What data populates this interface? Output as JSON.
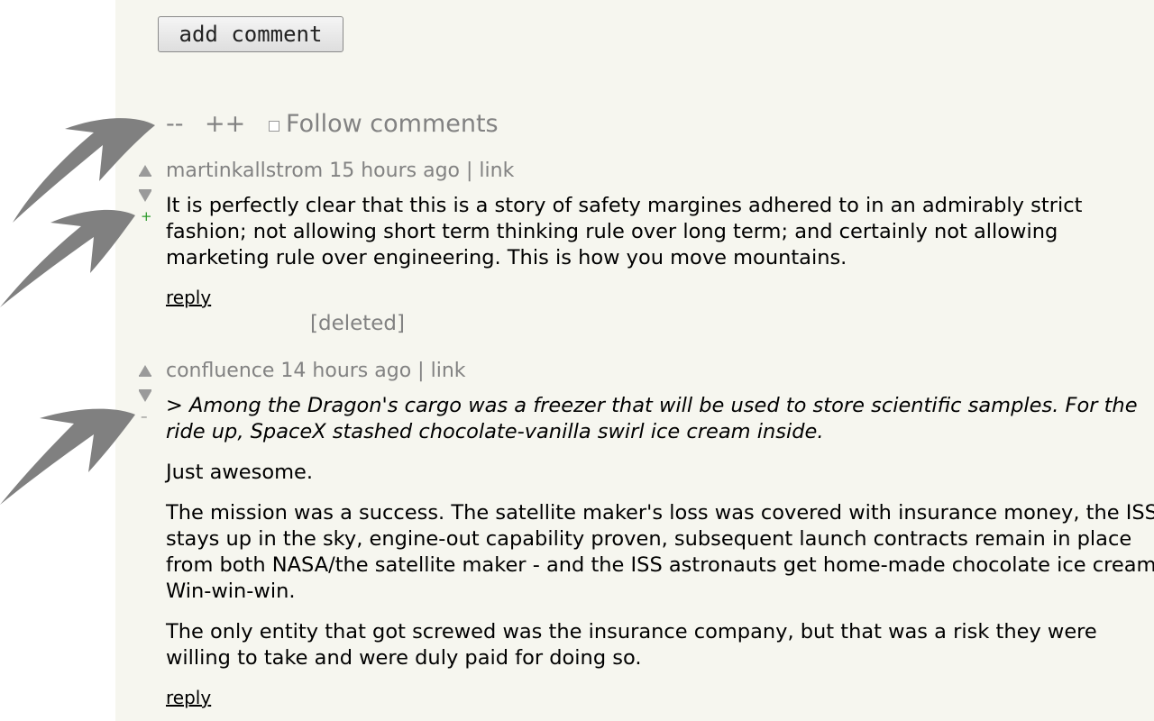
{
  "toolbar": {
    "add_comment_label": "add comment"
  },
  "controls": {
    "collapse_all": "--",
    "expand_all": "++",
    "follow_label": "Follow comments"
  },
  "comments": [
    {
      "author": "martinkallstrom",
      "age": "15 hours ago",
      "separator": "|",
      "link": "link",
      "toggle": "+",
      "paragraphs": [
        "It is perfectly clear that this is a story of safety margines adhered to in an admirably strict fashion; not allowing short term thinking rule over long term; and certainly not allowing marketing rule over engineering. This is how you move mountains."
      ],
      "reply": "reply"
    },
    {
      "deleted": "[deleted]"
    },
    {
      "author": "confluence",
      "age": "14 hours ago",
      "separator": "|",
      "link": "link",
      "toggle": "–",
      "quote": "> Among the Dragon's cargo was a freezer that will be used to store scientific samples. For the ride up, SpaceX stashed chocolate-vanilla swirl ice cream inside.",
      "paragraphs": [
        "Just awesome.",
        "The mission was a success. The satellite maker's loss was covered with insurance money, the ISS stays up in the sky, engine-out capability proven, subsequent launch contracts remain in place from both NASA/the satellite maker - and the ISS astronauts get home-made chocolate ice cream! Win-win-win.",
        "The only entity that got screwed was the insurance company, but that was a risk they were willing to take and were duly paid for doing so."
      ],
      "reply": "reply"
    }
  ],
  "colors": {
    "page_bg": "#f6f6ef",
    "meta_text": "#828282",
    "toggle_plus": "#2a9a2a",
    "annotation_arrow": "#808080"
  }
}
